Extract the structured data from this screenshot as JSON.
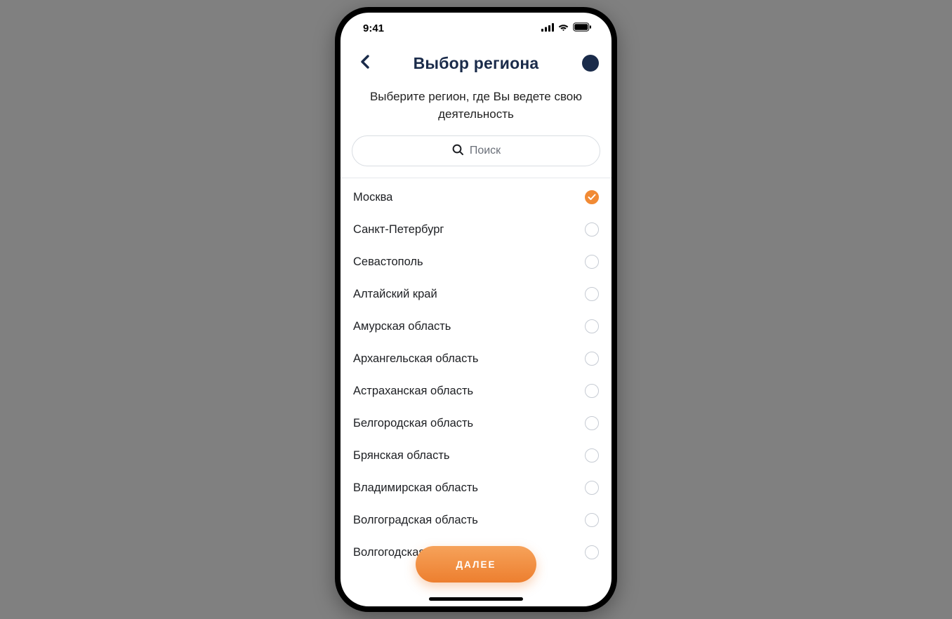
{
  "status": {
    "time": "9:41"
  },
  "nav": {
    "title": "Выбор региона"
  },
  "subtitle": "Выберите регион, где Вы ведете свою деятельность",
  "search": {
    "placeholder": "Поиск"
  },
  "regions": [
    {
      "name": "Москва",
      "selected": true
    },
    {
      "name": "Санкт-Петербург",
      "selected": false
    },
    {
      "name": "Севастополь",
      "selected": false
    },
    {
      "name": "Алтайский край",
      "selected": false
    },
    {
      "name": "Амурская область",
      "selected": false
    },
    {
      "name": "Архангельская область",
      "selected": false
    },
    {
      "name": "Астраханская область",
      "selected": false
    },
    {
      "name": "Белгородская область",
      "selected": false
    },
    {
      "name": "Брянская область",
      "selected": false
    },
    {
      "name": "Владимирская область",
      "selected": false
    },
    {
      "name": "Волгоградская область",
      "selected": false
    },
    {
      "name": "Волгогодская область",
      "selected": false
    }
  ],
  "cta": {
    "label": "ДАЛЕЕ"
  },
  "colors": {
    "accent": "#f18a34",
    "navy": "#1a2b4a"
  }
}
